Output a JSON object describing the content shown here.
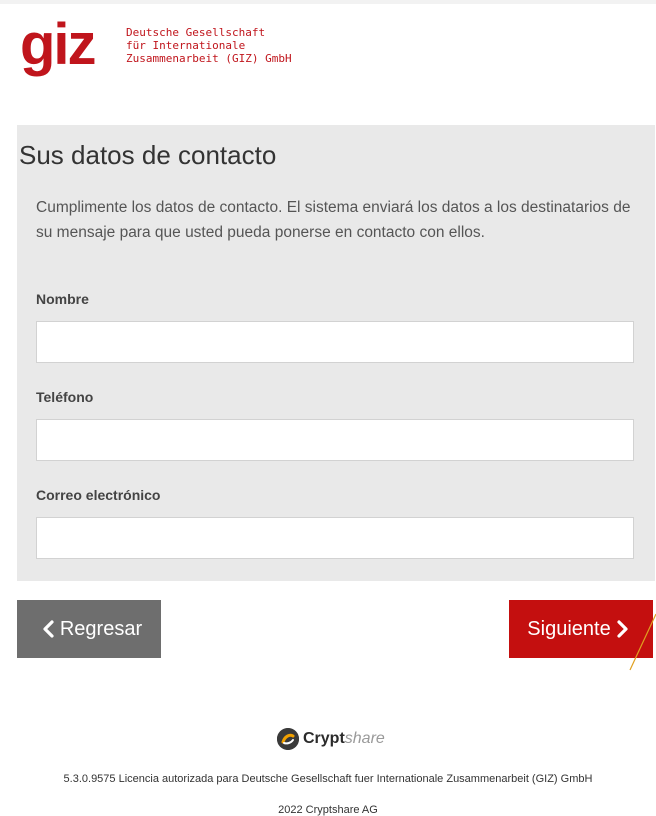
{
  "header": {
    "logo_mark": "giz",
    "logo_lines": [
      "Deutsche Gesellschaft",
      "für Internationale",
      "Zusammenarbeit (GIZ) GmbH"
    ]
  },
  "contact_form": {
    "title": "Sus datos de contacto",
    "description": "Cumplimente los datos de contacto. El sistema enviará los datos a los destinatarios de su mensaje para que usted pueda ponerse en contacto con ellos.",
    "fields": [
      {
        "label": "Nombre",
        "value": "",
        "placeholder": ""
      },
      {
        "label": "Teléfono",
        "value": "",
        "placeholder": ""
      },
      {
        "label": "Correo electrónico",
        "value": "",
        "placeholder": ""
      }
    ]
  },
  "actions": {
    "back_label": "Regresar",
    "next_label": "Siguiente"
  },
  "footer": {
    "brand_bold": "Crypt",
    "brand_light": "share",
    "license": "5.3.0.9575 Licencia autorizada para Deutsche Gesellschaft fuer Internationale Zusammenarbeit (GIZ) GmbH",
    "copyright": "2022 Cryptshare AG"
  },
  "colors": {
    "brand_red": "#c0151c",
    "next_button": "#c40f0f",
    "back_button": "#6e6e6e",
    "panel_bg": "#e9e9e9"
  },
  "icons": {
    "back": "chevron-left-icon",
    "next": "chevron-right-icon",
    "footer_logo": "cryptshare-logo-icon"
  }
}
